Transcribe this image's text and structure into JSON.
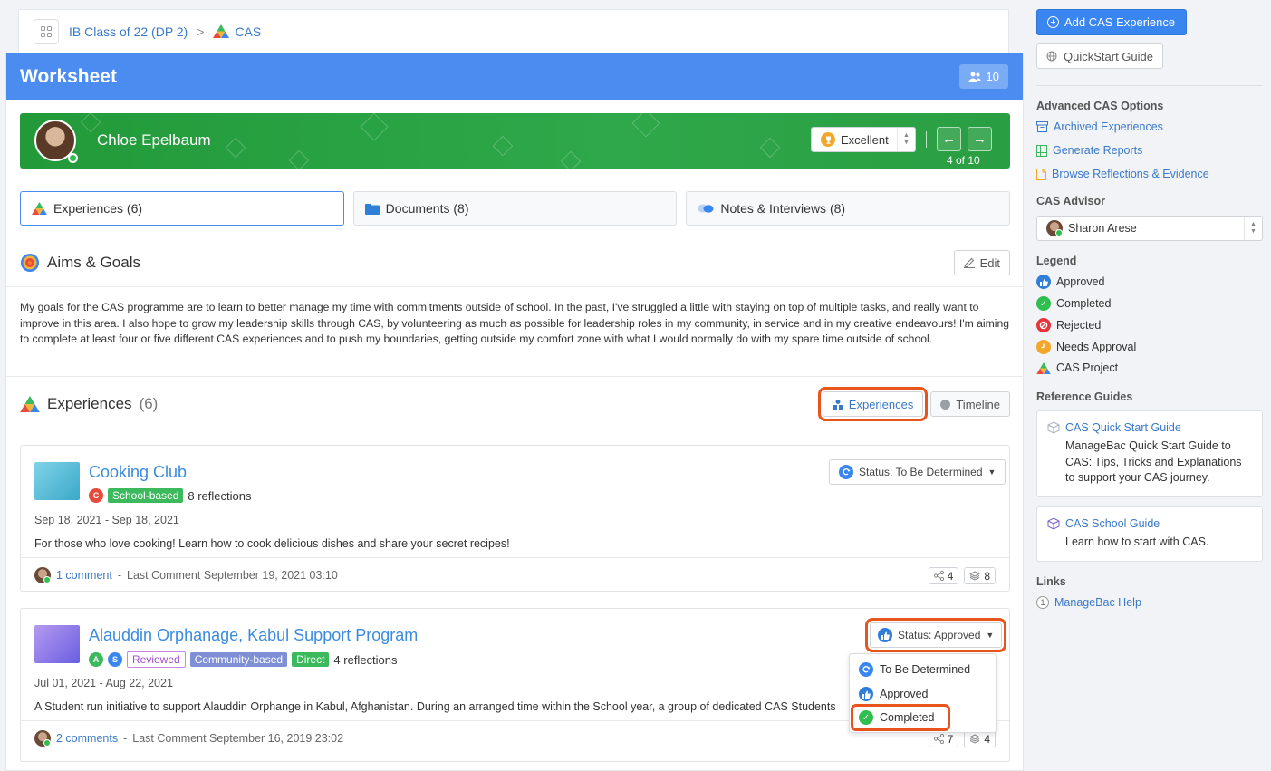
{
  "breadcrumb": {
    "class_name": "IB Class of 22 (DP 2)",
    "separator": ">",
    "section": "CAS"
  },
  "worksheet": {
    "title": "Worksheet",
    "member_count": "10"
  },
  "student": {
    "name": "Chloe Epelbaum",
    "grade": "Excellent",
    "pager": "4 of 10"
  },
  "tabs": [
    {
      "label": "Experiences (6)"
    },
    {
      "label": "Documents (8)"
    },
    {
      "label": "Notes & Interviews (8)"
    }
  ],
  "aims": {
    "title": "Aims & Goals",
    "edit_label": "Edit",
    "text": "My goals for the CAS programme are to learn to better manage my time with commitments outside of school. In the past, I've struggled a little with staying on top of multiple tasks, and really want to improve in this area. I also hope to grow my leadership skills through CAS, by volunteering as much as possible for leadership roles in my community, in service and in my creative endeavours! I'm aiming to complete at least four or five different CAS experiences and to push my boundaries, getting outside my comfort zone with what I would normally do with my spare time outside of school."
  },
  "experiences": {
    "title": "Experiences",
    "count": "(6)",
    "view_experiences": "Experiences",
    "view_timeline": "Timeline",
    "items": [
      {
        "title": "Cooking Club",
        "badges": [
          "C"
        ],
        "tags": [
          "School-based"
        ],
        "reflections": "8 reflections",
        "dates": "Sep 18, 2021 - Sep 18, 2021",
        "description": "For those who love cooking! Learn how to cook delicious dishes and share your secret recipes!",
        "comments": "1 comment",
        "last_comment": "Last Comment September 19, 2021 03:10",
        "outcomes": "4",
        "evidence": "8",
        "status": "Status: To Be Determined"
      },
      {
        "title": "Alauddin Orphanage, Kabul Support Program",
        "badges": [
          "A",
          "S"
        ],
        "tags": [
          "Reviewed",
          "Community-based",
          "Direct"
        ],
        "reflections": "4 reflections",
        "dates": "Jul 01, 2021 - Aug 22, 2021",
        "description": "A Student run initiative to support Alauddin Orphange in Kabul, Afghanistan. During an arranged time within the School year, a group of dedicated CAS Students",
        "comments": "2 comments",
        "last_comment": "Last Comment September 16, 2019 23:02",
        "outcomes": "7",
        "evidence": "4",
        "status": "Status: Approved"
      }
    ]
  },
  "status_dropdown": {
    "options": [
      "To Be Determined",
      "Approved",
      "Completed"
    ]
  },
  "sidebar": {
    "add_button": "Add CAS Experience",
    "quickstart_button": "QuickStart Guide",
    "advanced_heading": "Advanced CAS Options",
    "advanced_links": [
      "Archived Experiences",
      "Generate Reports",
      "Browse Reflections & Evidence"
    ],
    "advisor_heading": "CAS Advisor",
    "advisor_name": "Sharon Arese",
    "legend_heading": "Legend",
    "legend": [
      "Approved",
      "Completed",
      "Rejected",
      "Needs Approval",
      "CAS Project"
    ],
    "reference_heading": "Reference Guides",
    "guides": [
      {
        "title": "CAS Quick Start Guide",
        "desc": "ManageBac Quick Start Guide to CAS: Tips, Tricks and Explanations to support your CAS journey."
      },
      {
        "title": "CAS School Guide",
        "desc": "Learn how to start with CAS."
      }
    ],
    "links_heading": "Links",
    "help_link": "ManageBac Help"
  },
  "colors": {
    "primary": "#4a8cf0",
    "banner_green": "#2ea84a",
    "highlight": "#e8541c",
    "link": "#3a79c9"
  }
}
